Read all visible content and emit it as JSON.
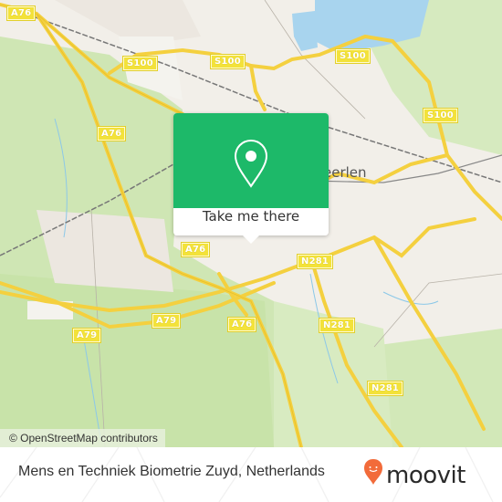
{
  "map": {
    "city_label": "Heerlen",
    "visible_city_fragment": "eerlen",
    "road_shields": [
      {
        "label": "A76"
      },
      {
        "label": "S100"
      },
      {
        "label": "S100"
      },
      {
        "label": "S100"
      },
      {
        "label": "S100"
      },
      {
        "label": "A76"
      },
      {
        "label": "A76"
      },
      {
        "label": "N281"
      },
      {
        "label": "A79"
      },
      {
        "label": "A79"
      },
      {
        "label": "A76"
      },
      {
        "label": "N281"
      },
      {
        "label": "N281"
      }
    ],
    "attribution": "© OpenStreetMap contributors"
  },
  "popup": {
    "icon": "map-pin-icon",
    "cta_label": "Take me there",
    "accent_color": "#1db969"
  },
  "footer": {
    "place_name": "Mens en Techniek Biometrie Zuyd, Netherlands",
    "brand": "moovit",
    "brand_color": "#f26b3a"
  }
}
